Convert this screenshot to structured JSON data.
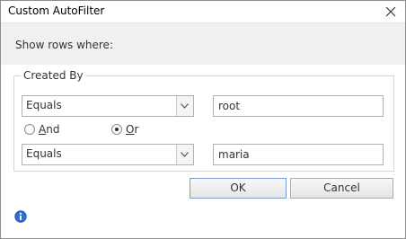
{
  "window": {
    "title": "Custom AutoFilter"
  },
  "header": {
    "instruction": "Show rows where:"
  },
  "group": {
    "label": "Created By"
  },
  "condition1": {
    "operator": "Equals",
    "value": "root"
  },
  "logic": {
    "and_label": "And",
    "or_label": "Or",
    "selected": "Or"
  },
  "condition2": {
    "operator": "Equals",
    "value": "maria"
  },
  "buttons": {
    "ok_label": "OK",
    "cancel_label": "Cancel"
  },
  "icons": {
    "close": "close-icon",
    "dropdown": "chevron-down-icon",
    "info": "info-icon"
  },
  "colors": {
    "info_blue": "#2f6fd1",
    "header_band": "#f0f0f0",
    "default_button_border": "#7a9cd3"
  }
}
